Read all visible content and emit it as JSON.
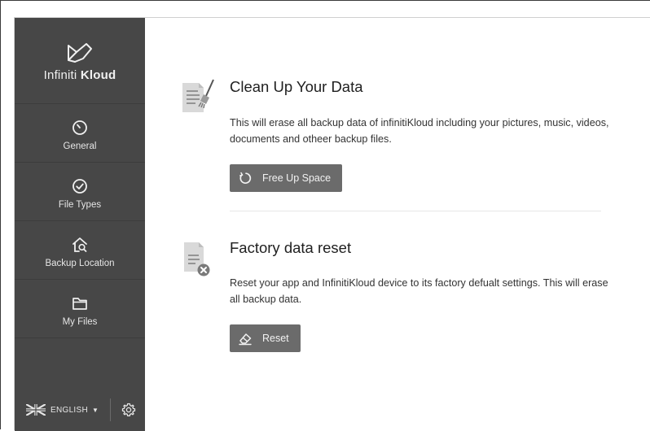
{
  "brand": {
    "name_light": "Infiniti",
    "name_bold": "Kloud"
  },
  "sidebar": {
    "items": [
      {
        "label": "General",
        "icon": "gauge-icon"
      },
      {
        "label": "File Types",
        "icon": "check-circle-icon"
      },
      {
        "label": "Backup Location",
        "icon": "home-search-icon"
      },
      {
        "label": "My Files",
        "icon": "folder-icon"
      }
    ]
  },
  "footer": {
    "language": "ENGLISH",
    "flag": "uk-flag-icon",
    "caret": "▼"
  },
  "cleanup": {
    "title": "Clean Up Your Data",
    "description": "This will erase all backup data of infinitiKloud including your pictures, music, videos, documents and otheer backup files.",
    "button_label": "Free Up Space"
  },
  "reset": {
    "title": "Factory data reset",
    "description": "Reset your app and InfinitiKloud device to its factory defualt settings. This will erase all backup data.",
    "button_label": "Reset"
  },
  "colors": {
    "sidebar_bg": "#474747",
    "button_bg": "#6b6b6b",
    "text": "#2b2b2b"
  }
}
